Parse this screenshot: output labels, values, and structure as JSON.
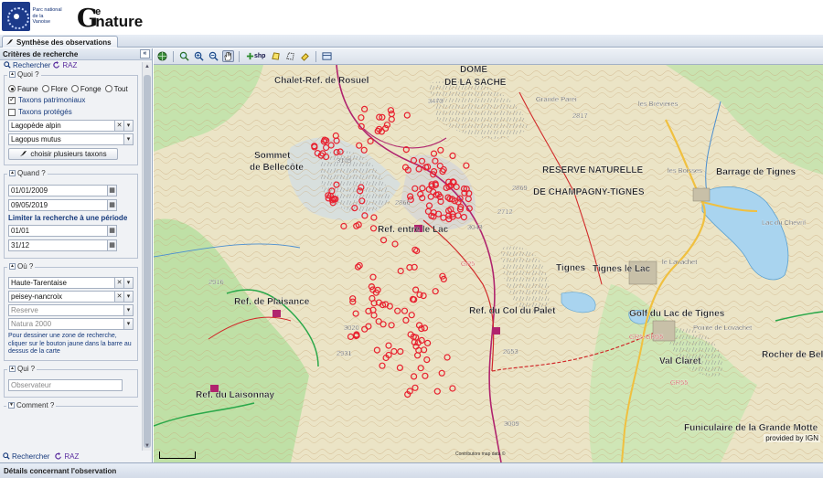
{
  "header": {
    "park_logo_text": "Parc national de la Vanoise",
    "app_logo": {
      "g": "G",
      "e": "e",
      "nature": "nature"
    }
  },
  "tabs": [
    {
      "label": "Synthèse des observations",
      "active": true
    }
  ],
  "panel": {
    "title": "Critères de recherche",
    "collapse_symbol": "«",
    "search_label": "Rechercher",
    "raz_label": "RAZ",
    "quoi": {
      "legend": "Quoi ?",
      "radios": [
        {
          "label": "Faune",
          "checked": true
        },
        {
          "label": "Flore",
          "checked": false
        },
        {
          "label": "Fonge",
          "checked": false
        },
        {
          "label": "Tout",
          "checked": false
        }
      ],
      "checks": [
        {
          "label": "Taxons patrimoniaux",
          "checked": true
        },
        {
          "label": "Taxons protégés",
          "checked": false
        }
      ],
      "taxon_fr": "Lagopède alpin",
      "taxon_lat": "Lagopus mutus",
      "multi_taxa_button": "choisir plusieurs taxons"
    },
    "quand": {
      "legend": "Quand ?",
      "date_start": "01/01/2009",
      "date_end": "09/05/2019",
      "period_label": "Limiter la recherche à une période",
      "period_start": "01/01",
      "period_end": "31/12"
    },
    "ou": {
      "legend": "Où ?",
      "secteur": "Haute-Tarentaise",
      "commune": "peisey-nancroix",
      "reserve_placeholder": "Reserve",
      "natura_placeholder": "Natura 2000",
      "note": "Pour dessiner une zone de recherche, cliquer sur le bouton jaune dans la barre au dessus de la carte"
    },
    "qui": {
      "legend": "Qui ?",
      "observer_placeholder": "Observateur"
    },
    "comment": {
      "legend": "Comment ?"
    }
  },
  "toolbar": {
    "shp_label": "shp"
  },
  "map": {
    "attribution": "provided by IGN",
    "copyright": "Contributors map data ©",
    "labels": [
      {
        "text": "Chalet-Ref. de Rosuel",
        "bold": true
      },
      {
        "text": "DOME",
        "bold": true
      },
      {
        "text": "DE LA SACHE",
        "bold": true
      },
      {
        "text": "Sommet",
        "bold": true
      },
      {
        "text": "de Bellecôte",
        "bold": true
      },
      {
        "text": "RESERVE NATURELLE",
        "bold": true
      },
      {
        "text": "DE CHAMPAGNY-TIGNES",
        "bold": true
      },
      {
        "text": "Tignes",
        "bold": true
      },
      {
        "text": "Tignes le Lac",
        "bold": true
      },
      {
        "text": "Barrage de Tignes",
        "bold": true
      },
      {
        "text": "Lac du Chevril",
        "bold": false
      },
      {
        "text": "Ref. entre le Lac",
        "bold": true
      },
      {
        "text": "Ref. de Plaisance",
        "bold": true
      },
      {
        "text": "Ref. du Col du Palet",
        "bold": true
      },
      {
        "text": "Ref. du Laisonnay",
        "bold": true
      },
      {
        "text": "Golf du Lac de Tignes",
        "bold": true
      },
      {
        "text": "Val Claret",
        "bold": true
      },
      {
        "text": "Rocher de Bellevarde",
        "bold": true
      },
      {
        "text": "Funiculaire de la Grande Motte",
        "bold": true
      },
      {
        "text": "Pointe de Lovachet",
        "bold": false
      },
      {
        "text": "Grande Parei",
        "bold": false
      },
      {
        "text": "les Brévières",
        "bold": false
      },
      {
        "text": "les Boisses",
        "bold": false
      },
      {
        "text": "le Lavachet",
        "bold": false
      },
      {
        "text": "3473",
        "bold": false
      },
      {
        "text": "3109",
        "bold": false
      },
      {
        "text": "2866",
        "bold": false
      },
      {
        "text": "3043",
        "bold": false
      },
      {
        "text": "2916",
        "bold": false
      },
      {
        "text": "3020",
        "bold": false
      },
      {
        "text": "2931",
        "bold": false
      },
      {
        "text": "2653",
        "bold": false
      },
      {
        "text": "3009",
        "bold": false
      },
      {
        "text": "2869",
        "bold": false
      },
      {
        "text": "2712",
        "bold": false
      },
      {
        "text": "2817",
        "bold": false
      },
      {
        "text": "GR5",
        "bold": false
      },
      {
        "text": "GR55",
        "bold": false
      },
      {
        "text": "GR5-GR55",
        "bold": false
      }
    ]
  },
  "bottom_bar": {
    "title": "Détails concernant l'observation"
  }
}
